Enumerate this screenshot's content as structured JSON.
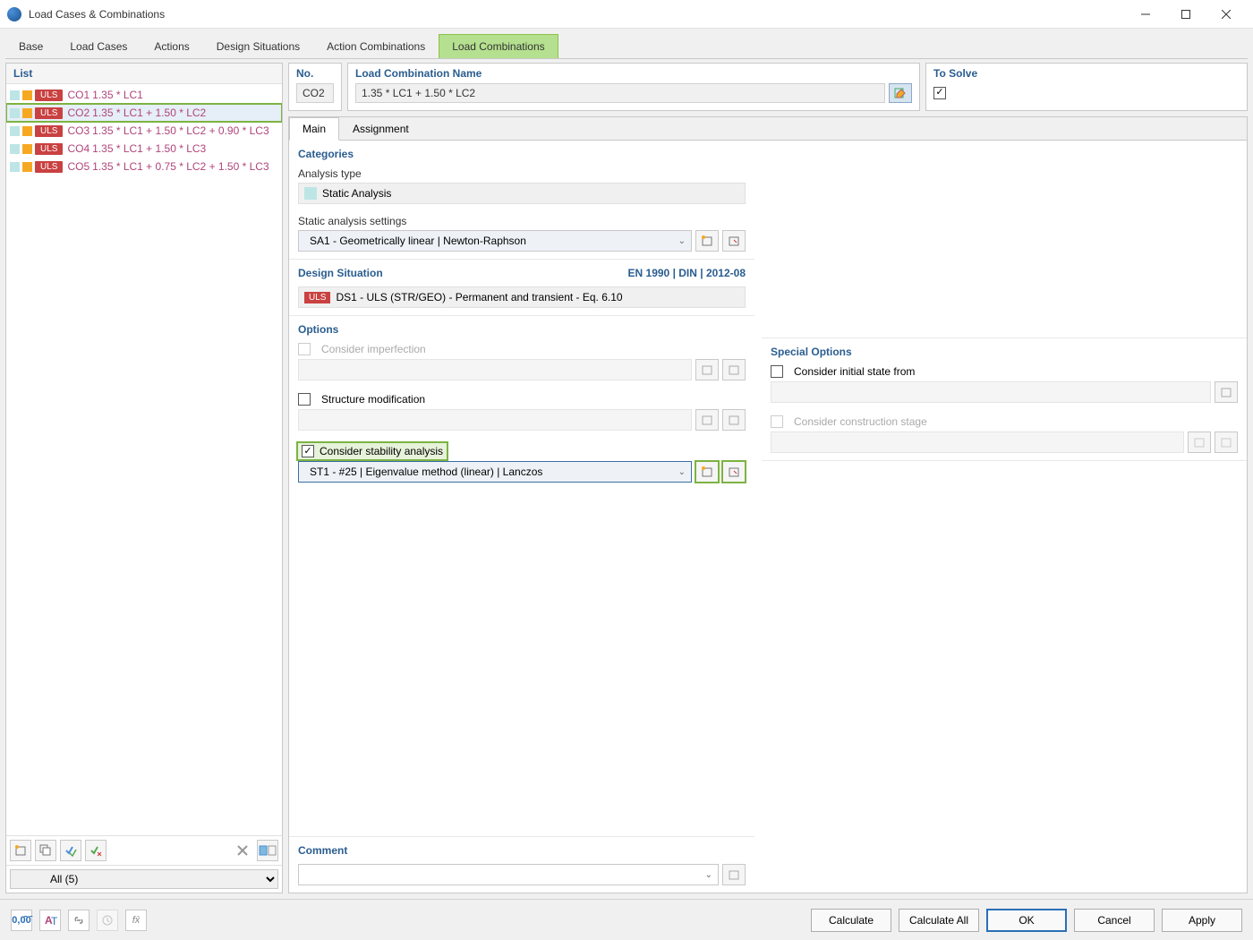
{
  "window": {
    "title": "Load Cases & Combinations"
  },
  "tabs": [
    "Base",
    "Load Cases",
    "Actions",
    "Design Situations",
    "Action Combinations",
    "Load Combinations"
  ],
  "active_tab": 5,
  "list_panel": {
    "header": "List",
    "rows": [
      {
        "badge": "ULS",
        "id": "CO1",
        "desc": "1.35 * LC1",
        "selected": false
      },
      {
        "badge": "ULS",
        "id": "CO2",
        "desc": "1.35 * LC1 + 1.50 * LC2",
        "selected": true
      },
      {
        "badge": "ULS",
        "id": "CO3",
        "desc": "1.35 * LC1 + 1.50 * LC2 + 0.90 * LC3",
        "selected": false
      },
      {
        "badge": "ULS",
        "id": "CO4",
        "desc": "1.35 * LC1 + 1.50 * LC3",
        "selected": false
      },
      {
        "badge": "ULS",
        "id": "CO5",
        "desc": "1.35 * LC1 + 0.75 * LC2 + 1.50 * LC3",
        "selected": false
      }
    ],
    "filter": "All (5)"
  },
  "top": {
    "no_label": "No.",
    "no_value": "CO2",
    "name_label": "Load Combination Name",
    "name_value": "1.35 * LC1 + 1.50 * LC2",
    "solve_label": "To Solve",
    "solve_checked": true
  },
  "subtabs": [
    "Main",
    "Assignment"
  ],
  "active_subtab": 0,
  "categories": {
    "title": "Categories",
    "analysis_type_label": "Analysis type",
    "analysis_type_value": "Static Analysis",
    "static_settings_label": "Static analysis settings",
    "static_settings_value": "SA1 - Geometrically linear | Newton-Raphson"
  },
  "design_situation": {
    "title": "Design Situation",
    "standard": "EN 1990 | DIN | 2012-08",
    "badge": "ULS",
    "value": "DS1 - ULS (STR/GEO) - Permanent and transient - Eq. 6.10"
  },
  "options": {
    "title": "Options",
    "consider_imperfection": "Consider imperfection",
    "structure_modification": "Structure modification",
    "consider_stability": "Consider stability analysis",
    "stability_value": "ST1 - #25 | Eigenvalue method (linear) | Lanczos"
  },
  "special_options": {
    "title": "Special Options",
    "initial_state": "Consider initial state from",
    "construction_stage": "Consider construction stage"
  },
  "comment": {
    "title": "Comment"
  },
  "footer": {
    "calculate": "Calculate",
    "calculate_all": "Calculate All",
    "ok": "OK",
    "cancel": "Cancel",
    "apply": "Apply"
  }
}
